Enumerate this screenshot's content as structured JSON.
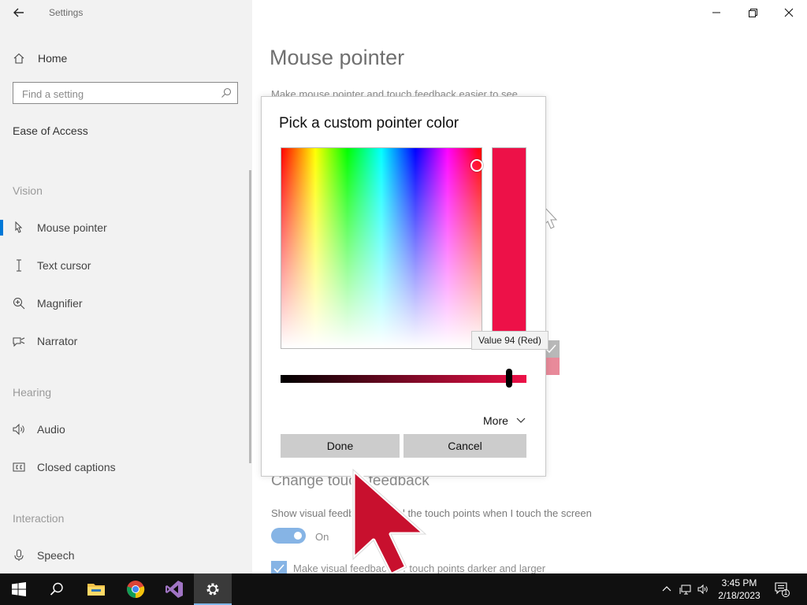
{
  "app": {
    "title": "Settings"
  },
  "sidebar": {
    "home_label": "Home",
    "search_placeholder": "Find a setting",
    "category": "Ease of Access",
    "groups": {
      "vision": "Vision",
      "hearing": "Hearing",
      "interaction": "Interaction"
    },
    "items": [
      {
        "label": "Mouse pointer",
        "icon": "mouse-pointer-icon",
        "active": true
      },
      {
        "label": "Text cursor",
        "icon": "text-cursor-icon"
      },
      {
        "label": "Magnifier",
        "icon": "magnifier-icon"
      },
      {
        "label": "Narrator",
        "icon": "narrator-icon"
      },
      {
        "label": "Audio",
        "icon": "audio-icon"
      },
      {
        "label": "Closed captions",
        "icon": "closed-captions-icon"
      },
      {
        "label": "Speech",
        "icon": "microphone-icon"
      }
    ]
  },
  "main": {
    "title": "Mouse pointer",
    "description": "Make mouse pointer and touch feedback easier to see",
    "touch_section_title": "Change touch feedback",
    "touch_description": "Show visual feedback around the touch points when I touch the screen",
    "toggle_label": "On",
    "toggle_on": true,
    "checkbox_label": "Make visual feedback for touch points darker and larger",
    "checkbox_checked": true
  },
  "dialog": {
    "title": "Pick a custom pointer color",
    "selected_color": "#ed1148",
    "tooltip": "Value 94 (Red)",
    "value_percent": 94,
    "more_label": "More",
    "done_label": "Done",
    "cancel_label": "Cancel"
  },
  "colors": {
    "accent": "#0078d7",
    "pointer_color": "#c8102e",
    "taskbar": "#101010"
  },
  "taskbar": {
    "apps": [
      "windows-start-icon",
      "search-icon",
      "file-explorer-icon",
      "chrome-icon",
      "visual-studio-icon",
      "settings-gear-icon"
    ],
    "time": "3:45 PM",
    "date": "2/18/2023",
    "notification_count": "1"
  }
}
